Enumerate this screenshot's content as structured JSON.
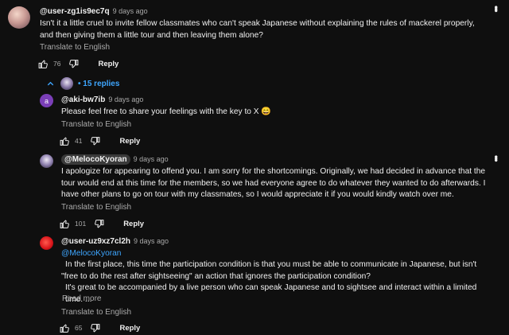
{
  "comment1": {
    "handle": "@user-zg1is9ec7q",
    "time": "9 days ago",
    "text": "Isn't it a little cruel to invite fellow classmates who can't speak Japanese without explaining the rules of mackerel properly, and then giving them a little tour and then leaving them alone?",
    "translate": "Translate to English",
    "likes": "76",
    "reply": "Reply"
  },
  "replies_toggle": {
    "label": "• 15 replies",
    "accent": "#3ea6ff"
  },
  "reply1": {
    "avatar_letter": "a",
    "avatar_color": "#7b3fb8",
    "handle": "@aki-bw7ib",
    "time": "9 days ago",
    "text": "Please feel free to share your feelings with the key to X 😄",
    "translate": "Translate to English",
    "likes": "41",
    "reply": "Reply"
  },
  "reply2": {
    "handle": "@MelocoKyoran",
    "time": "9 days ago",
    "text": "I apologize for appearing to offend you. I am sorry for the shortcomings. Originally, we had decided in advance that the tour would end at this time for the members, so we had everyone agree to do whatever they wanted to do afterwards. I have other plans to go on tour with my classmates, so I would appreciate it if you would kindly watch over me.",
    "translate": "Translate to English",
    "likes": "101",
    "reply": "Reply"
  },
  "reply3": {
    "handle": "@user-uz9xz7cl2h",
    "time": "9 days ago",
    "mention": "@MelocoKyoran",
    "text_line1": "In the first place, this time the participation condition is that you must be able to communicate in Japanese, but isn't \"free to do the rest after sightseeing\" an action that ignores the participation condition?",
    "text_line2": "It's great to be accompanied by a live person who can speak Japanese and to sightsee and interact within a limited time. ...",
    "read_more": "Read more",
    "translate": "Translate to English",
    "likes": "65",
    "reply": "Reply"
  }
}
